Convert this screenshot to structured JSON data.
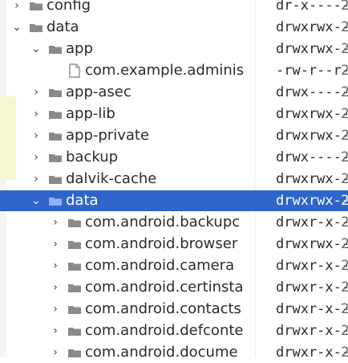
{
  "tree": {
    "rows": [
      {
        "name": "config",
        "perm": "dr-x------",
        "extra": "2"
      },
      {
        "name": "data",
        "perm": "drwxrwx--x",
        "extra": "2"
      },
      {
        "name": "app",
        "perm": "drwxrwx--x",
        "extra": "2"
      },
      {
        "name": "com.example.adminis",
        "perm": "-rw-r--r--",
        "extra": "2"
      },
      {
        "name": "app-asec",
        "perm": "drwx------",
        "extra": "2"
      },
      {
        "name": "app-lib",
        "perm": "drwxrwx--x",
        "extra": "2"
      },
      {
        "name": "app-private",
        "perm": "drwxrwx--x",
        "extra": "2"
      },
      {
        "name": "backup",
        "perm": "drwx------",
        "extra": "2"
      },
      {
        "name": "dalvik-cache",
        "perm": "drwxrwx--x",
        "extra": "2"
      },
      {
        "name": "data",
        "perm": "drwxrwx--x",
        "extra": "2"
      },
      {
        "name": "com.android.backupc",
        "perm": "drwxr-x--x",
        "extra": "2"
      },
      {
        "name": "com.android.browser",
        "perm": "drwxrwx--x",
        "extra": "2"
      },
      {
        "name": "com.android.camera",
        "perm": "drwxr-x--x",
        "extra": "2"
      },
      {
        "name": "com.android.certinsta",
        "perm": "drwxr-x--x",
        "extra": "2"
      },
      {
        "name": "com.android.contacts",
        "perm": "drwxr-x--x",
        "extra": "2"
      },
      {
        "name": "com.android.defconte",
        "perm": "drwxr-x--x",
        "extra": "2"
      },
      {
        "name": "com.android.docume",
        "perm": "drwxr-x--x",
        "extra": "2"
      }
    ]
  },
  "colors": {
    "selection": "#2f65ca",
    "folder": "#8a8a8a",
    "file_body": "#ffffff",
    "file_border": "#8f8f8f",
    "text": "#2b2b2b"
  }
}
